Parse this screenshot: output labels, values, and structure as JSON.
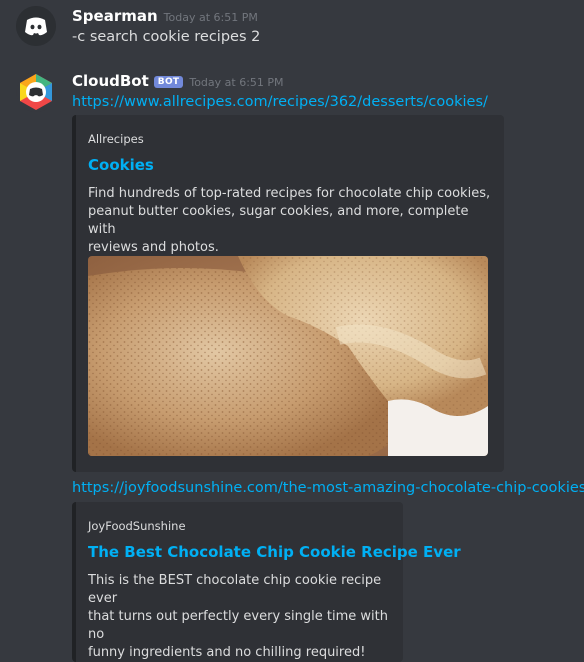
{
  "messages": [
    {
      "author": "Spearman",
      "timestamp": "Today at 6:51 PM",
      "text": "-c search cookie recipes 2"
    },
    {
      "author": "CloudBot",
      "badge": "BOT",
      "timestamp": "Today at 6:51 PM",
      "links": [
        "https://www.allrecipes.com/recipes/362/desserts/cookies/",
        "https://joyfoodsunshine.com/the-most-amazing-chocolate-chip-cookies/"
      ],
      "embeds": [
        {
          "provider": "Allrecipes",
          "title": "Cookies",
          "description": "Find hundreds of top-rated recipes for chocolate chip cookies,\npeanut butter cookies, sugar cookies, and more, complete with\nreviews and photos.",
          "image_icon": "cookie-photo"
        },
        {
          "provider": "JoyFoodSunshine",
          "title": "The Best Chocolate Chip Cookie Recipe Ever",
          "description": "This is the BEST chocolate chip cookie recipe ever\nthat turns out perfectly every single time with no\nfunny ingredients and no chilling required!"
        }
      ]
    }
  ],
  "colors": {
    "background": "#36393f",
    "embed_background": "#2f3136",
    "link": "#00b0f4",
    "bot_badge": "#7289da"
  }
}
